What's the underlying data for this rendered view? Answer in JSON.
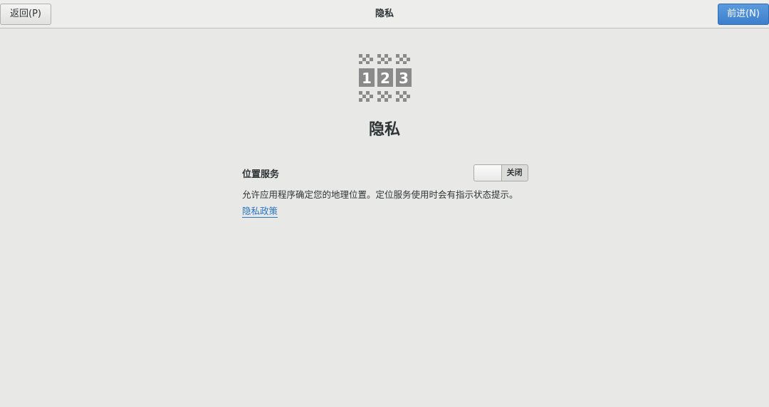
{
  "header": {
    "back_label": "返回(P)",
    "title": "隐私",
    "next_label": "前进(N)"
  },
  "main": {
    "title": "隐私",
    "icon": "privacy-123-icon",
    "location": {
      "label": "位置服务",
      "toggle_state": "关闭",
      "description": "允许应用程序确定您的地理位置。定位服务使用时会有指示状态提示。"
    },
    "policy_link": "隐私政策"
  },
  "colors": {
    "background": "#e8e8e7",
    "accent": "#3d7fcd",
    "link": "#2a76c6"
  }
}
